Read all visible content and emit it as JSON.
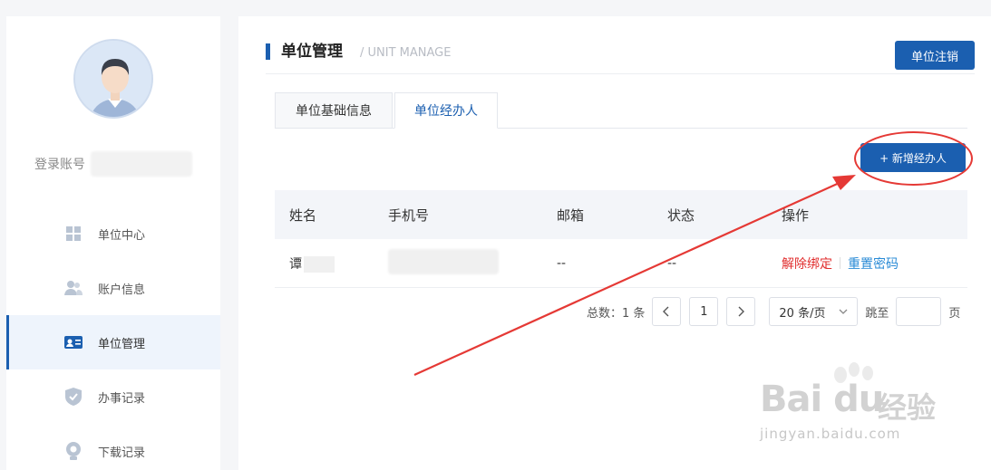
{
  "sidebar": {
    "account_label": "登录账号",
    "items": [
      {
        "label": "单位中心",
        "icon": "grid-icon"
      },
      {
        "label": "账户信息",
        "icon": "users-icon"
      },
      {
        "label": "单位管理",
        "icon": "id-card-icon",
        "active": true
      },
      {
        "label": "办事记录",
        "icon": "shield-check-icon"
      },
      {
        "label": "下载记录",
        "icon": "download-record-icon"
      }
    ]
  },
  "header": {
    "title": "单位管理",
    "subtitle": "/ UNIT MANAGE",
    "cancel_button": "单位注销"
  },
  "tabs": [
    {
      "label": "单位基础信息",
      "active": false
    },
    {
      "label": "单位经办人",
      "active": true
    }
  ],
  "add_button": "+ 新增经办人",
  "table": {
    "columns": [
      "姓名",
      "手机号",
      "邮箱",
      "状态",
      "操作"
    ],
    "rows": [
      {
        "name": "谭",
        "phone": "",
        "email": "--",
        "status": "--",
        "actions": [
          "解除绑定",
          "重置密码"
        ]
      }
    ]
  },
  "pagination": {
    "total_text": "总数：1 条",
    "current_page": "1",
    "prev": "‹",
    "next": "›",
    "page_size": "20 条/页",
    "jump_label": "跳至",
    "page_suffix": "页"
  },
  "watermark": {
    "brand": "Bai du",
    "cn": "经验",
    "url": "jingyan.baidu.com"
  },
  "colors": {
    "primary": "#1b5fb0",
    "danger": "#e12e2e",
    "link": "#2a8bd6",
    "annotation": "#e53935"
  }
}
